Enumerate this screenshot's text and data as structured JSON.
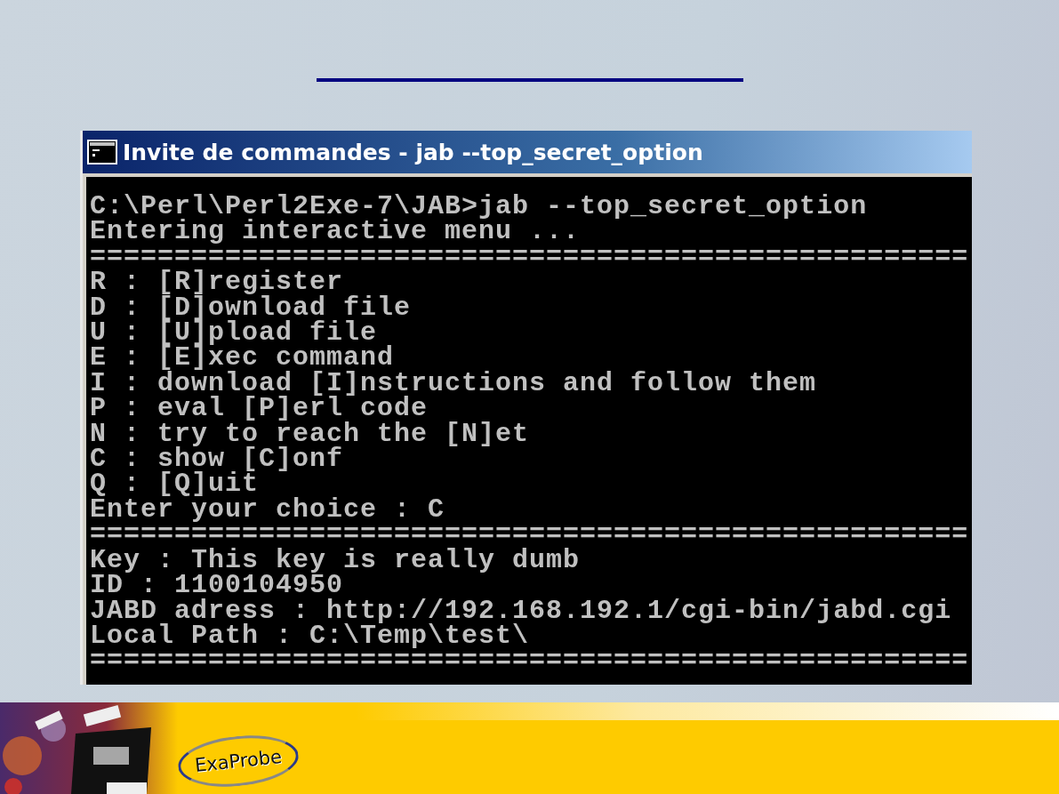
{
  "console": {
    "title": "Invite de commandes - jab --top_secret_option",
    "lines": [
      "C:\\Perl\\Perl2Exe-7\\JAB>jab --top_secret_option",
      "Entering interactive menu ...",
      "====================================================",
      "R : [R]register",
      "D : [D]ownload file",
      "U : [U]pload file",
      "E : [E]xec command",
      "I : download [I]nstructions and follow them",
      "P : eval [P]erl code",
      "N : try to reach the [N]et",
      "C : show [C]onf",
      "Q : [Q]uit",
      "Enter your choice : C",
      "====================================================",
      "Key : This key is really dumb",
      "ID : 1100104950",
      "JABD adress : http://192.168.192.1/cgi-bin/jabd.cgi",
      "Local Path : C:\\Temp\\test\\",
      "===================================================="
    ]
  },
  "footer": {
    "logo": "ExaProbe"
  }
}
